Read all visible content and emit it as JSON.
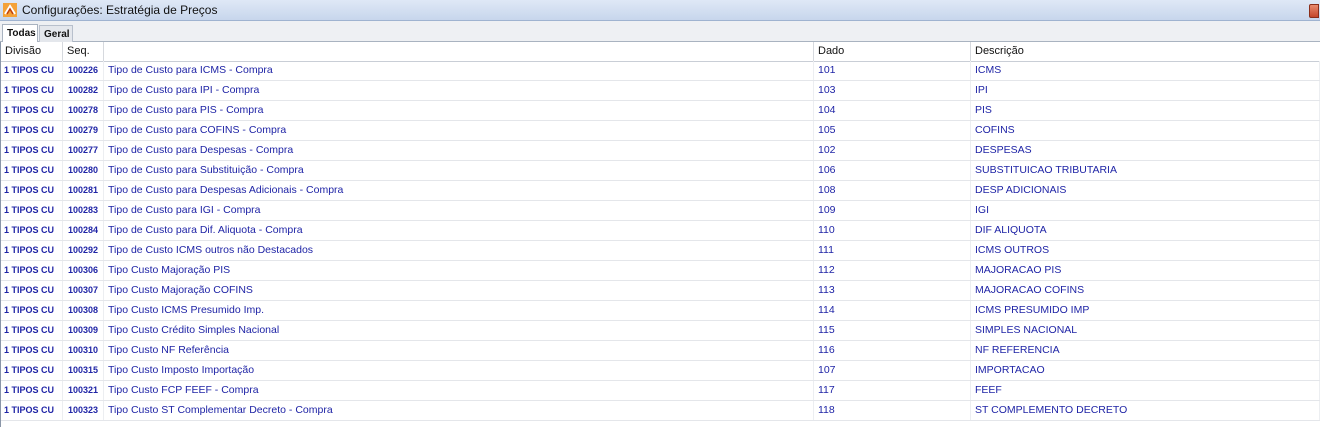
{
  "window": {
    "title": "Configurações: Estratégia de Preços"
  },
  "tabs": [
    {
      "label": "Todas"
    },
    {
      "label": "Geral"
    }
  ],
  "table": {
    "headers": {
      "divisao": "Divisão",
      "seq": "Seq.",
      "descricao": "",
      "dado": "Dado",
      "descricao2": "Descrição"
    },
    "rows": [
      {
        "divisao": "1 TIPOS CU",
        "seq": "100226",
        "descricao": "Tipo de Custo para ICMS - Compra",
        "dado": "101",
        "descricao2": "ICMS"
      },
      {
        "divisao": "1 TIPOS CU",
        "seq": "100282",
        "descricao": "Tipo de Custo para IPI - Compra",
        "dado": "103",
        "descricao2": "IPI"
      },
      {
        "divisao": "1 TIPOS CU",
        "seq": "100278",
        "descricao": "Tipo de Custo para PIS - Compra",
        "dado": "104",
        "descricao2": "PIS"
      },
      {
        "divisao": "1 TIPOS CU",
        "seq": "100279",
        "descricao": "Tipo de Custo para COFINS - Compra",
        "dado": "105",
        "descricao2": "COFINS"
      },
      {
        "divisao": "1 TIPOS CU",
        "seq": "100277",
        "descricao": "Tipo de Custo para Despesas - Compra",
        "dado": "102",
        "descricao2": "DESPESAS"
      },
      {
        "divisao": "1 TIPOS CU",
        "seq": "100280",
        "descricao": "Tipo de Custo para Substituição - Compra",
        "dado": "106",
        "descricao2": "SUBSTITUICAO TRIBUTARIA"
      },
      {
        "divisao": "1 TIPOS CU",
        "seq": "100281",
        "descricao": "Tipo de Custo para Despesas Adicionais - Compra",
        "dado": "108",
        "descricao2": "DESP ADICIONAIS"
      },
      {
        "divisao": "1 TIPOS CU",
        "seq": "100283",
        "descricao": "Tipo de Custo para IGI - Compra",
        "dado": "109",
        "descricao2": "IGI"
      },
      {
        "divisao": "1 TIPOS CU",
        "seq": "100284",
        "descricao": "Tipo de Custo para Dif. Aliquota - Compra",
        "dado": "110",
        "descricao2": "DIF ALIQUOTA"
      },
      {
        "divisao": "1 TIPOS CU",
        "seq": "100292",
        "descricao": "Tipo de Custo ICMS outros não Destacados",
        "dado": "111",
        "descricao2": "ICMS OUTROS"
      },
      {
        "divisao": "1 TIPOS CU",
        "seq": "100306",
        "descricao": "Tipo Custo Majoração PIS",
        "dado": "112",
        "descricao2": "MAJORACAO PIS"
      },
      {
        "divisao": "1 TIPOS CU",
        "seq": "100307",
        "descricao": "Tipo Custo Majoração COFINS",
        "dado": "113",
        "descricao2": "MAJORACAO COFINS"
      },
      {
        "divisao": "1 TIPOS CU",
        "seq": "100308",
        "descricao": "Tipo Custo ICMS Presumido Imp.",
        "dado": "114",
        "descricao2": "ICMS PRESUMIDO IMP"
      },
      {
        "divisao": "1 TIPOS CU",
        "seq": "100309",
        "descricao": "Tipo Custo Crédito Simples Nacional",
        "dado": "115",
        "descricao2": "SIMPLES NACIONAL"
      },
      {
        "divisao": "1 TIPOS CU",
        "seq": "100310",
        "descricao": "Tipo Custo NF Referência",
        "dado": "116",
        "descricao2": "NF REFERENCIA"
      },
      {
        "divisao": "1 TIPOS CU",
        "seq": "100315",
        "descricao": "Tipo Custo Imposto Importação",
        "dado": "107",
        "descricao2": "IMPORTACAO"
      },
      {
        "divisao": "1 TIPOS CU",
        "seq": "100321",
        "descricao": "Tipo Custo FCP FEEF - Compra",
        "dado": "117",
        "descricao2": "FEEF"
      },
      {
        "divisao": "1 TIPOS CU",
        "seq": "100323",
        "descricao": "Tipo Custo ST Complementar Decreto - Compra",
        "dado": "118",
        "descricao2": "ST COMPLEMENTO DECRETO"
      }
    ]
  }
}
